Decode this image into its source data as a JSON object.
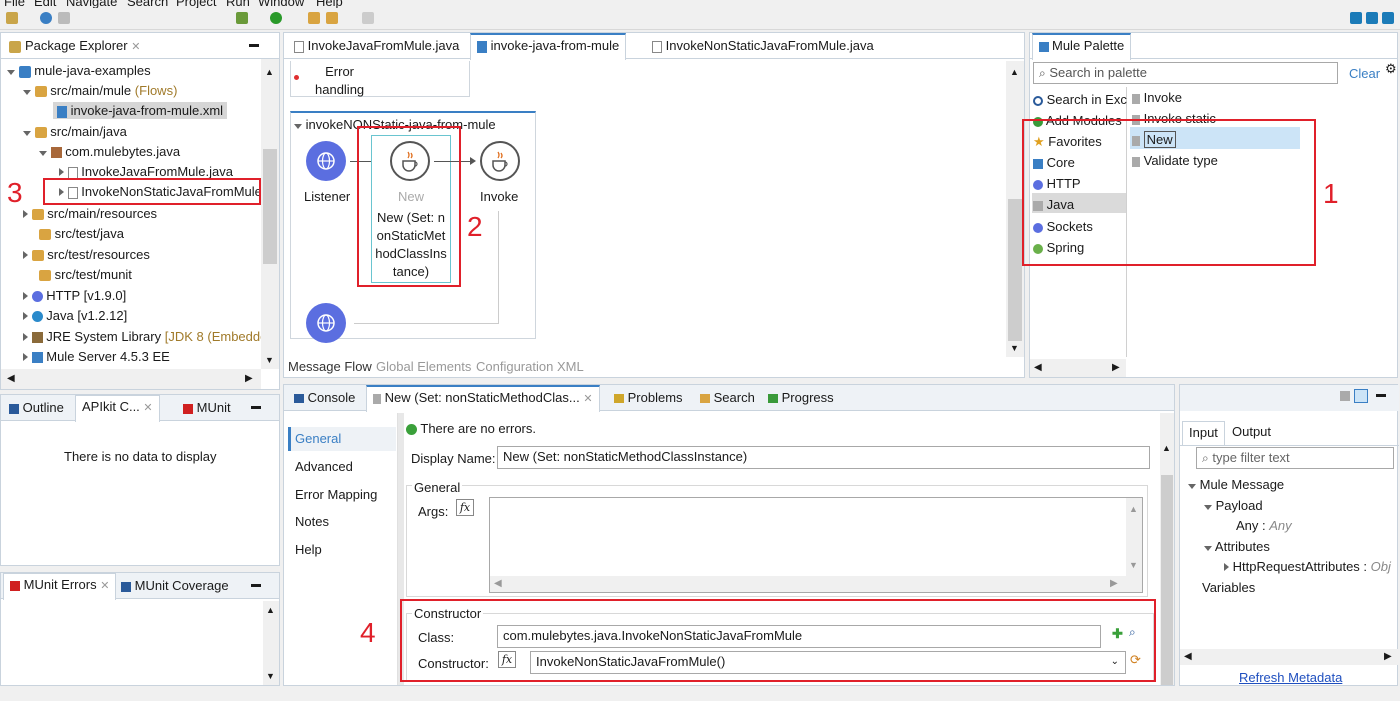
{
  "menu": [
    "File",
    "Edit",
    "Navigate",
    "Search",
    "Project",
    "Run",
    "Window",
    "Help"
  ],
  "package_explorer": {
    "title": "Package Explorer",
    "tree": [
      {
        "label": "mule-java-examples",
        "suffix": ""
      },
      {
        "label": "src/main/mule",
        "suffix": "(Flows)"
      },
      {
        "label": "invoke-java-from-mule.xml",
        "suffix": ""
      },
      {
        "label": "src/main/java",
        "suffix": ""
      },
      {
        "label": "com.mulebytes.java",
        "suffix": ""
      },
      {
        "label": "InvokeJavaFromMule.java",
        "suffix": ""
      },
      {
        "label": "InvokeNonStaticJavaFromMule.java",
        "suffix": ""
      },
      {
        "label": "src/main/resources",
        "suffix": ""
      },
      {
        "label": "src/test/java",
        "suffix": ""
      },
      {
        "label": "src/test/resources",
        "suffix": ""
      },
      {
        "label": "src/test/munit",
        "suffix": ""
      },
      {
        "label": "HTTP",
        "suffix": "[v1.9.0]"
      },
      {
        "label": "Java",
        "suffix": "[v1.2.12]"
      },
      {
        "label": "JRE System Library",
        "suffix": "[JDK 8 (Embedde"
      },
      {
        "label": "Mule Server 4.5.3 EE",
        "suffix": ""
      }
    ]
  },
  "outline": {
    "tabs": [
      "Outline",
      "APIkit C...",
      "MUnit"
    ],
    "empty": "There is no data to display"
  },
  "munit": {
    "tabs": [
      "MUnit Errors",
      "MUnit Coverage"
    ]
  },
  "editor": {
    "tabs": [
      "InvokeJavaFromMule.java",
      "invoke-java-from-mule",
      "InvokeNonStaticJavaFromMule.java"
    ],
    "error_handling": "Error\nhandling",
    "flow_name": "invokeNONStatic-java-from-mule",
    "listener": "Listener",
    "new_title": "New",
    "new_label": "New (Set: nonStaticMethodClassInstance)",
    "invoke": "Invoke",
    "bottom_tabs": [
      "Message Flow",
      "Global Elements",
      "Configuration XML"
    ]
  },
  "palette": {
    "title": "Mule Palette",
    "search_placeholder": "Search in palette",
    "clear": "Clear",
    "left": [
      "Search in Exc",
      "Add Modules",
      "Favorites",
      "Core",
      "HTTP",
      "Java",
      "Sockets",
      "Spring"
    ],
    "right": [
      "Invoke",
      "Invoke static",
      "New",
      "Validate type"
    ]
  },
  "bottom": {
    "tabs": [
      "Console",
      "New (Set: nonStaticMethodClas...",
      "Problems",
      "Search",
      "Progress"
    ],
    "nav": [
      "General",
      "Advanced",
      "Error Mapping",
      "Notes",
      "Help"
    ],
    "no_errors": "There are no errors.",
    "display_name_label": "Display Name:",
    "display_name_value": "New (Set: nonStaticMethodClassInstance)",
    "general_label": "General",
    "args_label": "Args:",
    "fx": "fx",
    "constructor_section": "Constructor",
    "class_label": "Class:",
    "class_value": "com.mulebytes.java.InvokeNonStaticJavaFromMule",
    "constructor_label": "Constructor:",
    "constructor_value": "InvokeNonStaticJavaFromMule()"
  },
  "metadata": {
    "tabs": [
      "Input",
      "Output"
    ],
    "filter_placeholder": "type filter text",
    "tree": [
      "Mule Message",
      "Payload",
      "Any :",
      "Any",
      "Attributes",
      "HttpRequestAttributes :",
      "Obj",
      "Variables"
    ],
    "refresh": "Refresh Metadata"
  },
  "annotations": [
    "1",
    "2",
    "3",
    "4"
  ],
  "colors": {
    "annotation": "#e0202a",
    "mule_blue": "#5b6ee0",
    "link": "#1f4fbf"
  }
}
